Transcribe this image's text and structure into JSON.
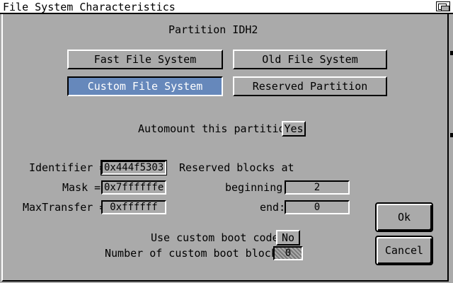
{
  "window": {
    "title": "File System Characteristics"
  },
  "partition_label": "Partition IDH2",
  "fs_buttons": {
    "fast": "Fast File System",
    "old": "Old File System",
    "custom": "Custom File System",
    "reserved": "Reserved Partition"
  },
  "automount": {
    "label": "Automount this partition?",
    "value": "Yes"
  },
  "fields": {
    "identifier_label": "Identifier =",
    "identifier_value": "0x444f5303",
    "mask_label": "Mask =",
    "mask_value": "0x7ffffffe",
    "maxtransfer_label": "MaxTransfer =",
    "maxtransfer_value": "0xffffff"
  },
  "reserved_blocks": {
    "heading": "Reserved blocks at",
    "beginning_label": "beginning:",
    "beginning_value": "2",
    "end_label": "end:",
    "end_value": "0"
  },
  "boot": {
    "custom_label": "Use custom boot code?",
    "custom_value": "No",
    "blocks_label": "Number of custom boot blocks?",
    "blocks_value": "0"
  },
  "actions": {
    "ok": "Ok",
    "cancel": "Cancel"
  }
}
